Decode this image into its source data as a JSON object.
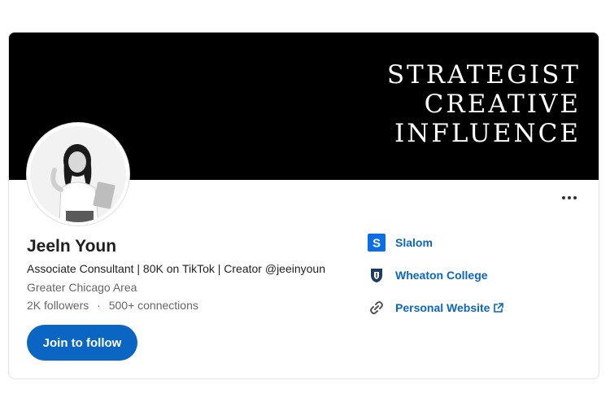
{
  "banner": {
    "lines": [
      "STRATEGIST",
      "CREATIVE",
      "INFLUENCE"
    ]
  },
  "profile": {
    "name": "Jeeln Youn",
    "headline": "Associate Consultant | 80K on TikTok | Creator @jeeinyoun",
    "location": "Greater Chicago Area",
    "followers": "2K followers",
    "separator": "·",
    "connections": "500+ connections"
  },
  "actions": {
    "follow_label": "Join to follow",
    "more_icon": "more-horizontal-icon"
  },
  "links": [
    {
      "label": "Slalom",
      "icon": "slalom-logo-icon"
    },
    {
      "label": "Wheaton College",
      "icon": "wheaton-college-crest-icon"
    },
    {
      "label": "Personal Website",
      "icon": "link-icon",
      "external_icon": "external-link-icon"
    }
  ],
  "colors": {
    "accent": "#0a66c2",
    "banner_bg": "#000000",
    "slalom_blue": "#0a6ee6"
  }
}
